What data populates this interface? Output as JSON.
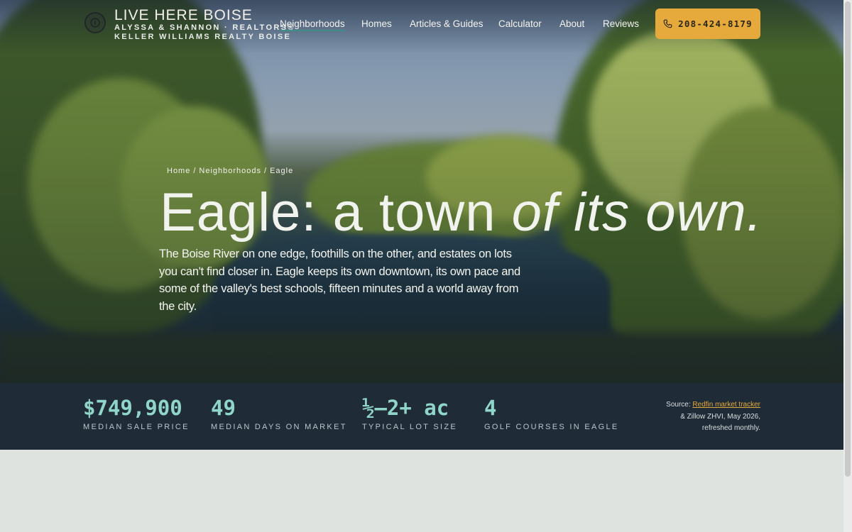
{
  "nav": {
    "brand_title": "LIVE HERE BOISE",
    "brand_subtitle": "ALYSSA & SHANNON · REALTORS®",
    "brand_company": "KELLER WILLIAMS REALTY BOISE",
    "links": [
      "Neighborhoods",
      "Homes",
      "Articles & Guides",
      "Calculator",
      "About",
      "Reviews"
    ],
    "active_link": "Neighborhoods",
    "phone": "208-424-8179"
  },
  "hero": {
    "breadcrumb": [
      "Home",
      "Neighborhoods",
      "Eagle"
    ],
    "headline_plain": "Eagle: a town",
    "headline_italic": "of its own.",
    "lede": "The Boise River on one edge, foothills on the other, and estates on lots you can't find closer in. Eagle keeps its own downtown, its own pace and some of the valley's best schools, fifteen minutes and a world away from the city."
  },
  "stats": [
    {
      "value": "$749,900",
      "label": "MEDIAN SALE PRICE"
    },
    {
      "value": "49",
      "label": "MEDIAN DAYS ON MARKET"
    },
    {
      "value": "½–2+ ac",
      "label": "TYPICAL LOT SIZE"
    },
    {
      "value": "4",
      "label": "GOLF COURSES IN EAGLE"
    }
  ],
  "source": {
    "prefix": "Source: ",
    "link": "Redfin market tracker",
    "line2": "& Zillow ZHVI, May 2026,",
    "line3": "refreshed monthly."
  },
  "colors": {
    "accent_gold": "#e5a93c",
    "stat_teal": "#8fd5ca",
    "band_navy": "#1f2b36",
    "nav_underline": "#3f8d87"
  },
  "icons": {
    "logo": "clock-compass-icon",
    "phone": "phone-icon"
  }
}
